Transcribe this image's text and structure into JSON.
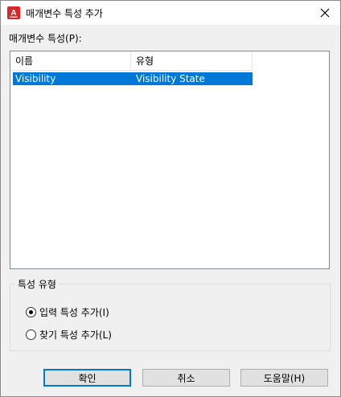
{
  "window": {
    "title": "매개변수 특성 추가"
  },
  "params_label": "매개변수 특성(P):",
  "list": {
    "columns": [
      "이름",
      "유형"
    ],
    "rows": [
      {
        "name": "Visibility",
        "type": "Visibility State",
        "selected": true
      }
    ]
  },
  "group": {
    "title": "특성 유형",
    "options": [
      {
        "label": "입력 특성 추가(I)",
        "checked": true
      },
      {
        "label": "찾기 특성 추가(L)",
        "checked": false
      }
    ]
  },
  "buttons": {
    "ok": "확인",
    "cancel": "취소",
    "help": "도움말(H)"
  },
  "colors": {
    "accent": "#0078d7",
    "app_icon": "#d8262b"
  }
}
